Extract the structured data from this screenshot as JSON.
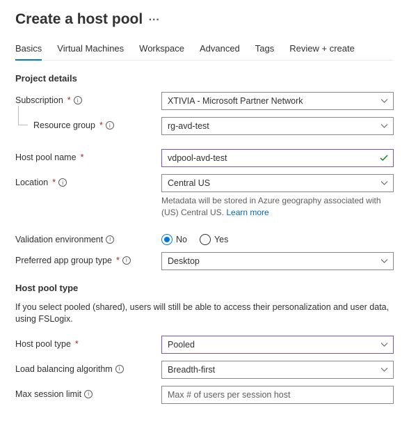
{
  "page": {
    "title": "Create a host pool"
  },
  "tabs": {
    "basics": "Basics",
    "vms": "Virtual Machines",
    "workspace": "Workspace",
    "advanced": "Advanced",
    "tags": "Tags",
    "review": "Review + create"
  },
  "sections": {
    "project": "Project details",
    "hostpool": "Host pool type"
  },
  "projectDetails": {
    "subscriptionLabel": "Subscription",
    "subscriptionValue": "XTIVIA - Microsoft Partner Network",
    "resourceGroupLabel": "Resource group",
    "resourceGroupValue": "rg-avd-test",
    "hostPoolNameLabel": "Host pool name",
    "hostPoolNameValue": "vdpool-avd-test",
    "locationLabel": "Location",
    "locationValue": "Central US",
    "locationHelp": "Metadata will be stored in Azure geography associated with (US) Central US. ",
    "locationLearnMore": "Learn more",
    "validationEnvLabel": "Validation environment",
    "validationNo": "No",
    "validationYes": "Yes",
    "appGroupTypeLabel": "Preferred app group type",
    "appGroupTypeValue": "Desktop"
  },
  "hostPoolType": {
    "desc": "If you select pooled (shared), users will still be able to access their personalization and user data, using FSLogix.",
    "typeLabel": "Host pool type",
    "typeValue": "Pooled",
    "lbLabel": "Load balancing algorithm",
    "lbValue": "Breadth-first",
    "maxSessionLabel": "Max session limit",
    "maxSessionPlaceholder": "Max # of users per session host"
  }
}
